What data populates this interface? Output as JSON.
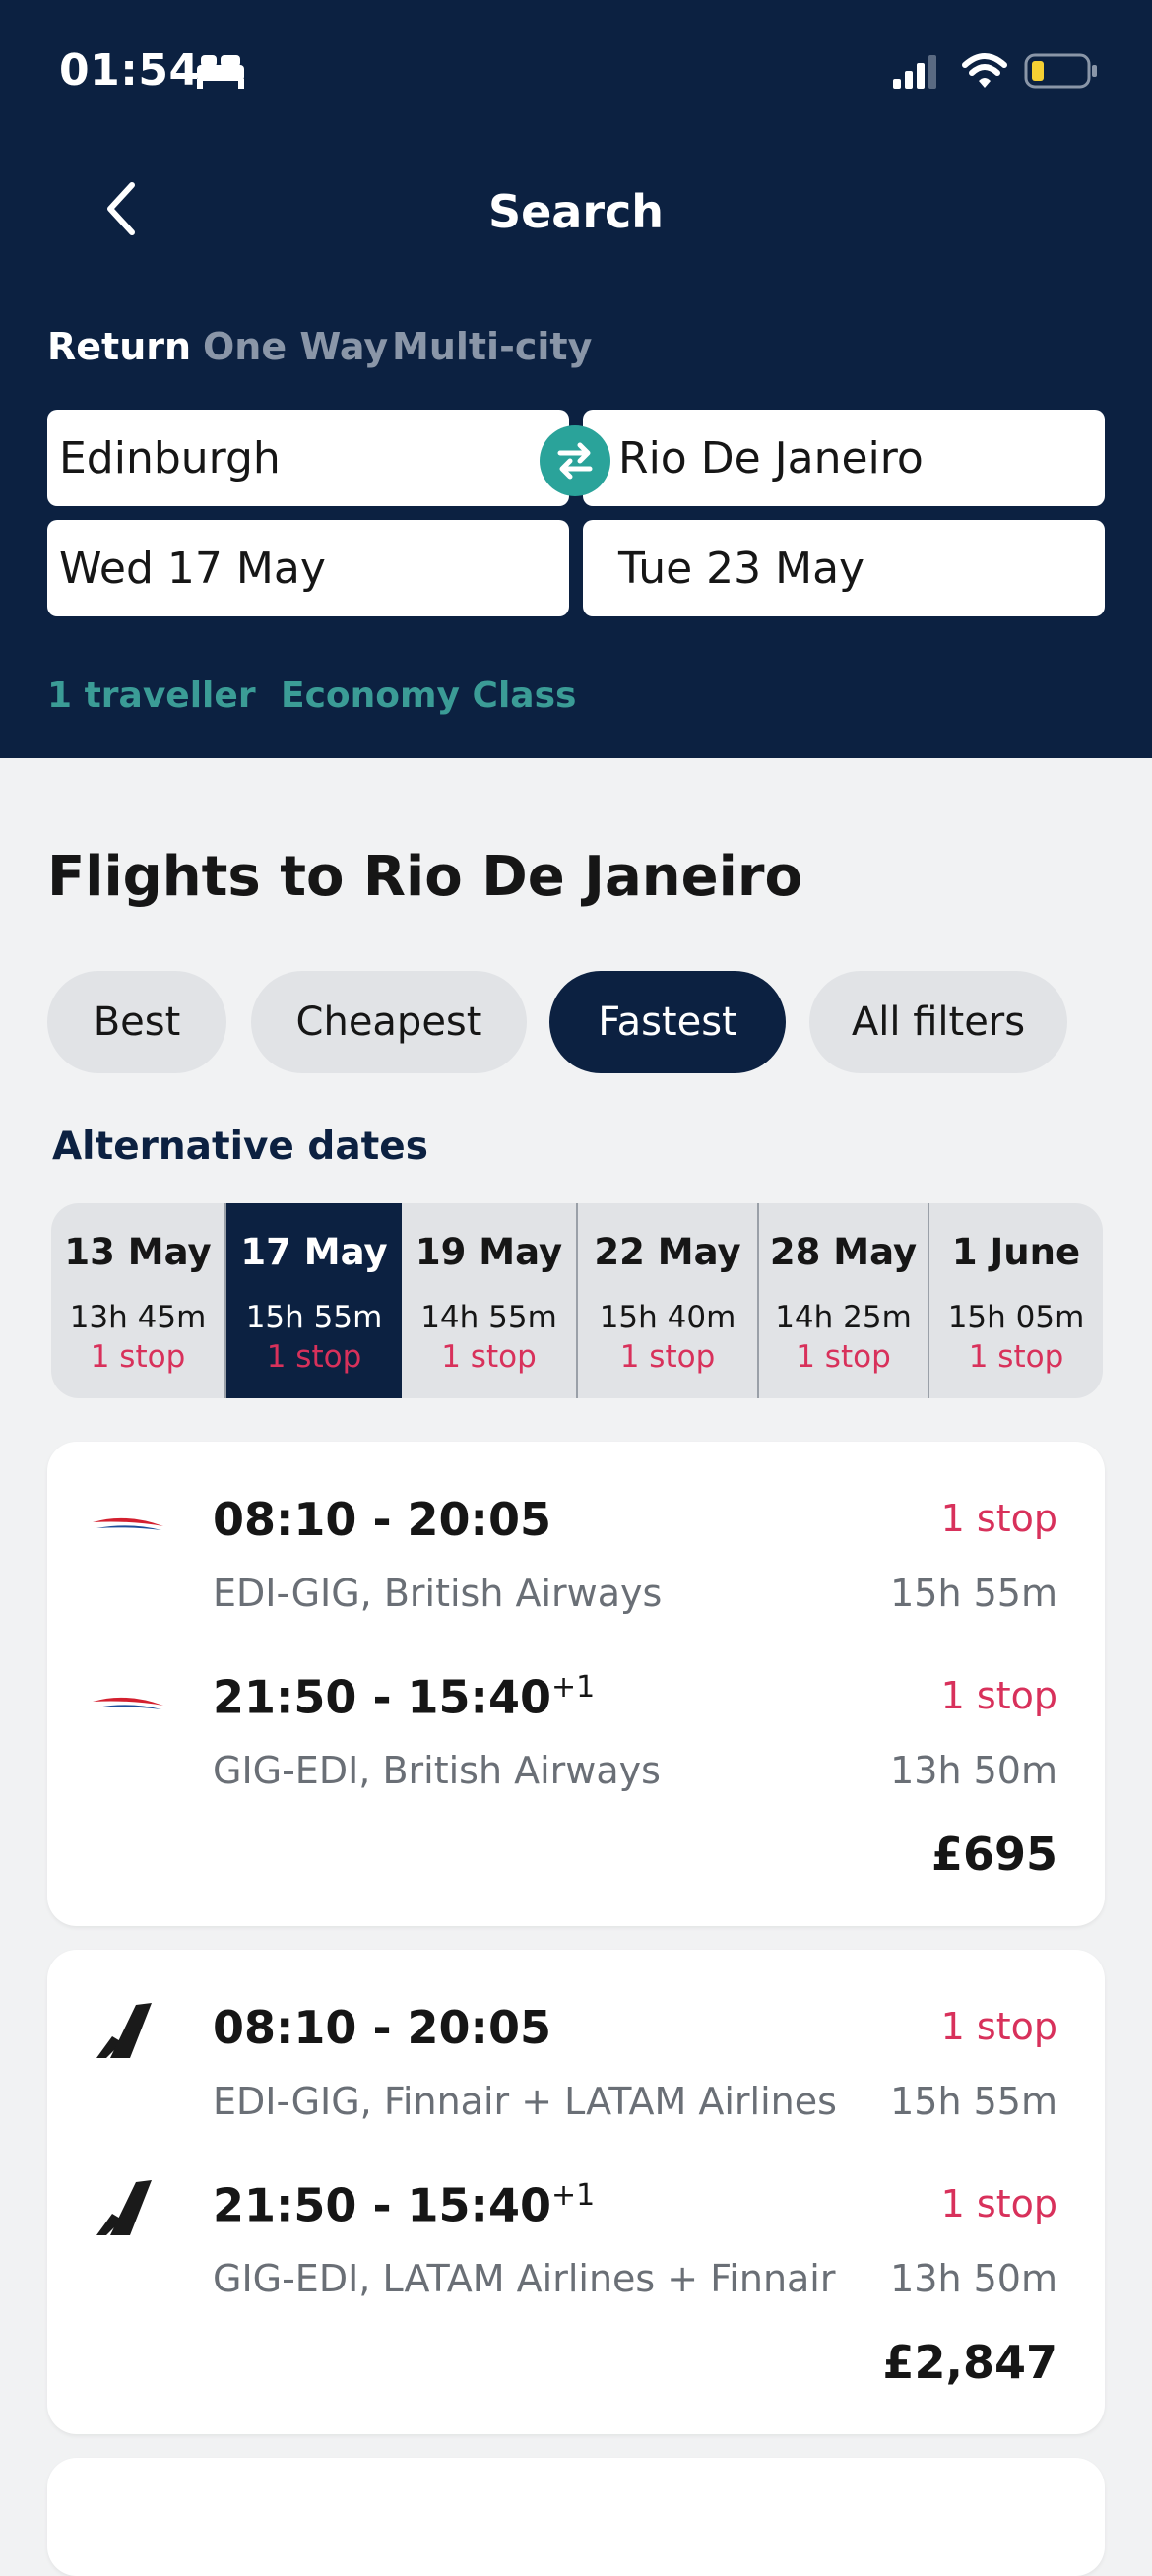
{
  "status_bar": {
    "time": "01:54"
  },
  "header": {
    "title": "Search"
  },
  "trip_types": [
    "Return",
    "One Way",
    "Multi-city"
  ],
  "search": {
    "origin": "Edinburgh",
    "destination": "Rio De Janeiro",
    "depart_date": "Wed 17 May",
    "return_date": "Tue 23 May",
    "travellers": "1 traveller",
    "cabin_class": "Economy Class"
  },
  "results_title": "Flights to Rio De Janeiro",
  "sort_chips": [
    "Best",
    "Cheapest",
    "Fastest",
    "All filters"
  ],
  "active_sort": "Fastest",
  "alternative_dates": {
    "title": "Alternative dates",
    "items": [
      {
        "date": "13 May",
        "duration": "13h 45m",
        "stops": "1 stop"
      },
      {
        "date": "17 May",
        "duration": "15h 55m",
        "stops": "1 stop"
      },
      {
        "date": "19 May",
        "duration": "14h 55m",
        "stops": "1 stop"
      },
      {
        "date": "22 May",
        "duration": "15h 40m",
        "stops": "1 stop"
      },
      {
        "date": "28 May",
        "duration": "14h 25m",
        "stops": "1 stop"
      },
      {
        "date": "1 June",
        "duration": "15h 05m",
        "stops": "1 stop"
      }
    ],
    "selected": "17 May"
  },
  "flights": [
    {
      "logo_icon": "british-airways-logo-icon",
      "legs": [
        {
          "times": "08:10 - 20:05",
          "day_offset": "",
          "route": "EDI-GIG, British Airways",
          "stops": "1 stop",
          "duration": "15h 55m"
        },
        {
          "times": "21:50 - 15:40",
          "day_offset": "+1",
          "route": "GIG-EDI, British Airways",
          "stops": "1 stop",
          "duration": "13h 50m"
        }
      ],
      "price": "£695"
    },
    {
      "logo_icon": "multi-airline-logo-icon",
      "legs": [
        {
          "times": "08:10 - 20:05",
          "day_offset": "",
          "route": "EDI-GIG, Finnair + LATAM Airlines",
          "stops": "1 stop",
          "duration": "15h 55m"
        },
        {
          "times": "21:50 - 15:40",
          "day_offset": "+1",
          "route": "GIG-EDI, LATAM Airlines + Finnair",
          "stops": "1 stop",
          "duration": "13h 50m"
        }
      ],
      "price": "£2,847"
    }
  ],
  "colors": {
    "header_bg": "#0c2141",
    "accent_teal": "#2aa39a",
    "stop_red": "#d8315b",
    "page_bg": "#f1f2f3"
  }
}
